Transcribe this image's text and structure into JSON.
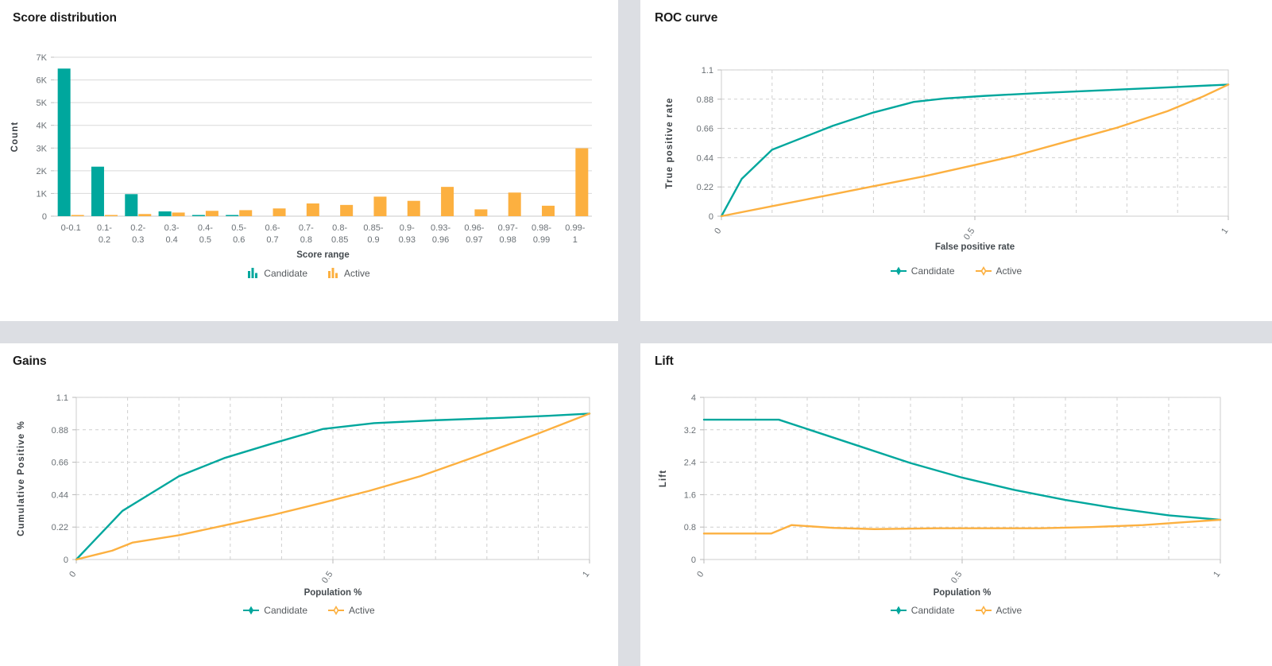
{
  "theme": {
    "candidate_color": "#00a79d",
    "active_color": "#fcb040",
    "page_background": "#dcdee3",
    "panel_background": "#ffffff",
    "grid_color": "#d4d4d4",
    "text_color": "#444a4f"
  },
  "panels": {
    "score_distribution": {
      "title": "Score distribution"
    },
    "roc_curve": {
      "title": "ROC curve"
    },
    "gains": {
      "title": "Gains"
    },
    "lift": {
      "title": "Lift"
    }
  },
  "legend": {
    "candidate": "Candidate",
    "active": "Active"
  },
  "chart_data": [
    {
      "id": "score-distribution",
      "type": "bar",
      "title": "Score distribution",
      "xlabel": "Score range",
      "ylabel": "Count",
      "ylim": [
        0,
        7000
      ],
      "yticks": [
        0,
        1000,
        2000,
        3000,
        4000,
        5000,
        6000,
        7000
      ],
      "ytick_labels": [
        "0",
        "1K",
        "2K",
        "3K",
        "4K",
        "5K",
        "6K",
        "7K"
      ],
      "grid": true,
      "legend_position": "bottom",
      "categories": [
        "0-0.1",
        "0.1-0.2",
        "0.2-0.3",
        "0.3-0.4",
        "0.4-0.5",
        "0.5-0.6",
        "0.6-0.7",
        "0.7-0.8",
        "0.8-0.85",
        "0.85-0.9",
        "0.9-0.93",
        "0.93-0.96",
        "0.96-0.97",
        "0.97-0.98",
        "0.98-0.99",
        "0.99-1"
      ],
      "series": [
        {
          "name": "Candidate",
          "color": "#00a79d",
          "values": [
            6500,
            2180,
            970,
            210,
            40,
            15,
            0,
            0,
            0,
            0,
            0,
            0,
            0,
            0,
            0,
            0
          ]
        },
        {
          "name": "Active",
          "color": "#fcb040",
          "values": [
            15,
            30,
            95,
            160,
            235,
            265,
            340,
            560,
            495,
            860,
            675,
            1290,
            300,
            1040,
            460,
            2990
          ]
        }
      ]
    },
    {
      "id": "roc-curve",
      "type": "line",
      "title": "ROC curve",
      "xlabel": "False positive rate",
      "ylabel": "True positive rate",
      "xlim": [
        0,
        1
      ],
      "ylim": [
        0,
        1.1
      ],
      "xticks": [
        0,
        0.5,
        1
      ],
      "xtick_labels": [
        "0",
        "0.5",
        "1"
      ],
      "yticks": [
        0,
        0.22,
        0.44,
        0.66,
        0.88,
        1.1
      ],
      "ytick_labels": [
        "0",
        "0.22",
        "0.44",
        "0.66",
        "0.88",
        "1.1"
      ],
      "grid": true,
      "legend_position": "bottom",
      "series": [
        {
          "name": "Candidate",
          "color": "#00a79d",
          "points": [
            [
              0,
              0
            ],
            [
              0.04,
              0.28
            ],
            [
              0.1,
              0.5
            ],
            [
              0.16,
              0.59
            ],
            [
              0.22,
              0.68
            ],
            [
              0.3,
              0.78
            ],
            [
              0.38,
              0.86
            ],
            [
              0.44,
              0.885
            ],
            [
              0.52,
              0.905
            ],
            [
              0.62,
              0.925
            ],
            [
              0.74,
              0.945
            ],
            [
              0.86,
              0.965
            ],
            [
              1,
              0.99
            ]
          ]
        },
        {
          "name": "Active",
          "color": "#fcb040",
          "points": [
            [
              0,
              0
            ],
            [
              0.1,
              0.075
            ],
            [
              0.22,
              0.165
            ],
            [
              0.3,
              0.225
            ],
            [
              0.4,
              0.3
            ],
            [
              0.5,
              0.385
            ],
            [
              0.58,
              0.455
            ],
            [
              0.68,
              0.56
            ],
            [
              0.78,
              0.665
            ],
            [
              0.88,
              0.79
            ],
            [
              0.95,
              0.9
            ],
            [
              1,
              0.99
            ]
          ]
        }
      ]
    },
    {
      "id": "gains",
      "type": "line",
      "title": "Gains",
      "xlabel": "Population %",
      "ylabel": "Cumulative Positive %",
      "xlim": [
        0,
        1
      ],
      "ylim": [
        0,
        1.1
      ],
      "xticks": [
        0,
        0.5,
        1
      ],
      "xtick_labels": [
        "0",
        "0.5",
        "1"
      ],
      "yticks": [
        0,
        0.22,
        0.44,
        0.66,
        0.88,
        1.1
      ],
      "ytick_labels": [
        "0",
        "0.22",
        "0.44",
        "0.66",
        "0.88",
        "1.1"
      ],
      "grid": true,
      "legend_position": "bottom",
      "series": [
        {
          "name": "Candidate",
          "color": "#00a79d",
          "points": [
            [
              0,
              0
            ],
            [
              0.09,
              0.33
            ],
            [
              0.2,
              0.565
            ],
            [
              0.29,
              0.69
            ],
            [
              0.38,
              0.785
            ],
            [
              0.48,
              0.885
            ],
            [
              0.58,
              0.925
            ],
            [
              0.7,
              0.945
            ],
            [
              0.82,
              0.96
            ],
            [
              0.92,
              0.975
            ],
            [
              1,
              0.99
            ]
          ]
        },
        {
          "name": "Active",
          "color": "#fcb040",
          "points": [
            [
              0,
              0
            ],
            [
              0.07,
              0.06
            ],
            [
              0.11,
              0.115
            ],
            [
              0.2,
              0.165
            ],
            [
              0.28,
              0.225
            ],
            [
              0.38,
              0.3
            ],
            [
              0.48,
              0.385
            ],
            [
              0.57,
              0.465
            ],
            [
              0.67,
              0.565
            ],
            [
              0.78,
              0.7
            ],
            [
              0.9,
              0.855
            ],
            [
              1,
              0.99
            ]
          ]
        }
      ]
    },
    {
      "id": "lift",
      "type": "line",
      "title": "Lift",
      "xlabel": "Population %",
      "ylabel": "Lift",
      "xlim": [
        0,
        1
      ],
      "ylim": [
        0,
        4
      ],
      "xticks": [
        0,
        0.5,
        1
      ],
      "xtick_labels": [
        "0",
        "0.5",
        "1"
      ],
      "yticks": [
        0,
        0.8,
        1.6,
        2.4,
        3.2,
        4
      ],
      "ytick_labels": [
        "0",
        "0.8",
        "1.6",
        "2.4",
        "3.2",
        "4"
      ],
      "grid": true,
      "legend_position": "bottom",
      "series": [
        {
          "name": "Candidate",
          "color": "#00a79d",
          "points": [
            [
              0,
              3.45
            ],
            [
              0.145,
              3.45
            ],
            [
              0.3,
              2.8
            ],
            [
              0.4,
              2.38
            ],
            [
              0.5,
              2.02
            ],
            [
              0.6,
              1.72
            ],
            [
              0.7,
              1.47
            ],
            [
              0.8,
              1.26
            ],
            [
              0.9,
              1.09
            ],
            [
              1,
              0.98
            ]
          ]
        },
        {
          "name": "Active",
          "color": "#fcb040",
          "points": [
            [
              0,
              0.64
            ],
            [
              0.13,
              0.64
            ],
            [
              0.17,
              0.85
            ],
            [
              0.25,
              0.78
            ],
            [
              0.33,
              0.75
            ],
            [
              0.45,
              0.77
            ],
            [
              0.55,
              0.77
            ],
            [
              0.65,
              0.77
            ],
            [
              0.75,
              0.8
            ],
            [
              0.85,
              0.85
            ],
            [
              0.93,
              0.92
            ],
            [
              1,
              0.98
            ]
          ]
        }
      ]
    }
  ]
}
